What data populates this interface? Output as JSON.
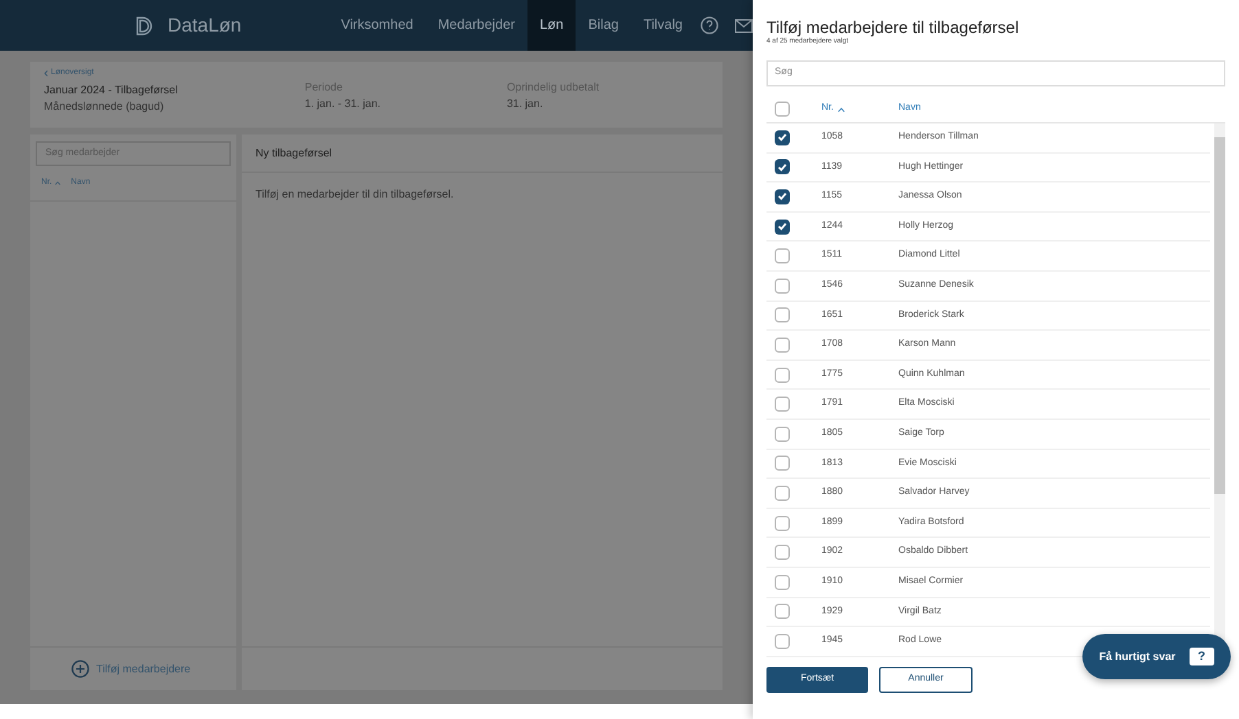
{
  "header": {
    "logo_text": "DataLøn",
    "nav": [
      {
        "label": "Virksomhed",
        "selected": false
      },
      {
        "label": "Medarbejder",
        "selected": false
      },
      {
        "label": "Løn",
        "selected": true
      },
      {
        "label": "Bilag",
        "selected": false
      },
      {
        "label": "Tilvalg",
        "selected": false
      }
    ]
  },
  "summary": {
    "back_link": "Lønoversigt",
    "title": "Januar 2024 - Tilbageførsel",
    "subtitle": "Månedslønnede (bagud)",
    "fields": [
      {
        "label": "Periode",
        "value": "1. jan. - 31. jan."
      },
      {
        "label": "Oprindelig udbetalt",
        "value": "31. jan."
      }
    ]
  },
  "employee_list": {
    "search_placeholder": "Søg medarbejder",
    "columns": [
      "Nr.",
      "Navn"
    ],
    "add_button": "Tilføj medarbejdere"
  },
  "main_panel": {
    "title": "Ny tilbageførsel",
    "message": "Tilføj en medarbejder til din tilbageførsel."
  },
  "drawer": {
    "title": "Tilføj medarbejdere til tilbageførsel",
    "subtitle": "4 af 25 medarbejdere valgt",
    "search_placeholder": "Søg",
    "select_all_checked": false,
    "columns": [
      "Nr.",
      "Navn"
    ],
    "rows": [
      {
        "nr": "1058",
        "name": "Henderson Tillman",
        "checked": true
      },
      {
        "nr": "1139",
        "name": "Hugh Hettinger",
        "checked": true
      },
      {
        "nr": "1155",
        "name": "Janessa Olson",
        "checked": true
      },
      {
        "nr": "1244",
        "name": "Holly Herzog",
        "checked": true
      },
      {
        "nr": "1511",
        "name": "Diamond Littel",
        "checked": false
      },
      {
        "nr": "1546",
        "name": "Suzanne Denesik",
        "checked": false
      },
      {
        "nr": "1651",
        "name": "Broderick Stark",
        "checked": false
      },
      {
        "nr": "1708",
        "name": "Karson Mann",
        "checked": false
      },
      {
        "nr": "1775",
        "name": "Quinn Kuhlman",
        "checked": false
      },
      {
        "nr": "1791",
        "name": "Elta Mosciski",
        "checked": false
      },
      {
        "nr": "1805",
        "name": "Saige Torp",
        "checked": false
      },
      {
        "nr": "1813",
        "name": "Evie Mosciski",
        "checked": false
      },
      {
        "nr": "1880",
        "name": "Salvador Harvey",
        "checked": false
      },
      {
        "nr": "1899",
        "name": "Yadira Botsford",
        "checked": false
      },
      {
        "nr": "1902",
        "name": "Osbaldo Dibbert",
        "checked": false
      },
      {
        "nr": "1910",
        "name": "Misael Cormier",
        "checked": false
      },
      {
        "nr": "1929",
        "name": "Virgil Batz",
        "checked": false
      },
      {
        "nr": "1945",
        "name": "Rod Lowe",
        "checked": false
      }
    ],
    "buttons": {
      "primary": "Fortsæt",
      "secondary": "Annuller"
    }
  },
  "help_button": {
    "label": "Få hurtigt svar",
    "icon_text": "?"
  }
}
